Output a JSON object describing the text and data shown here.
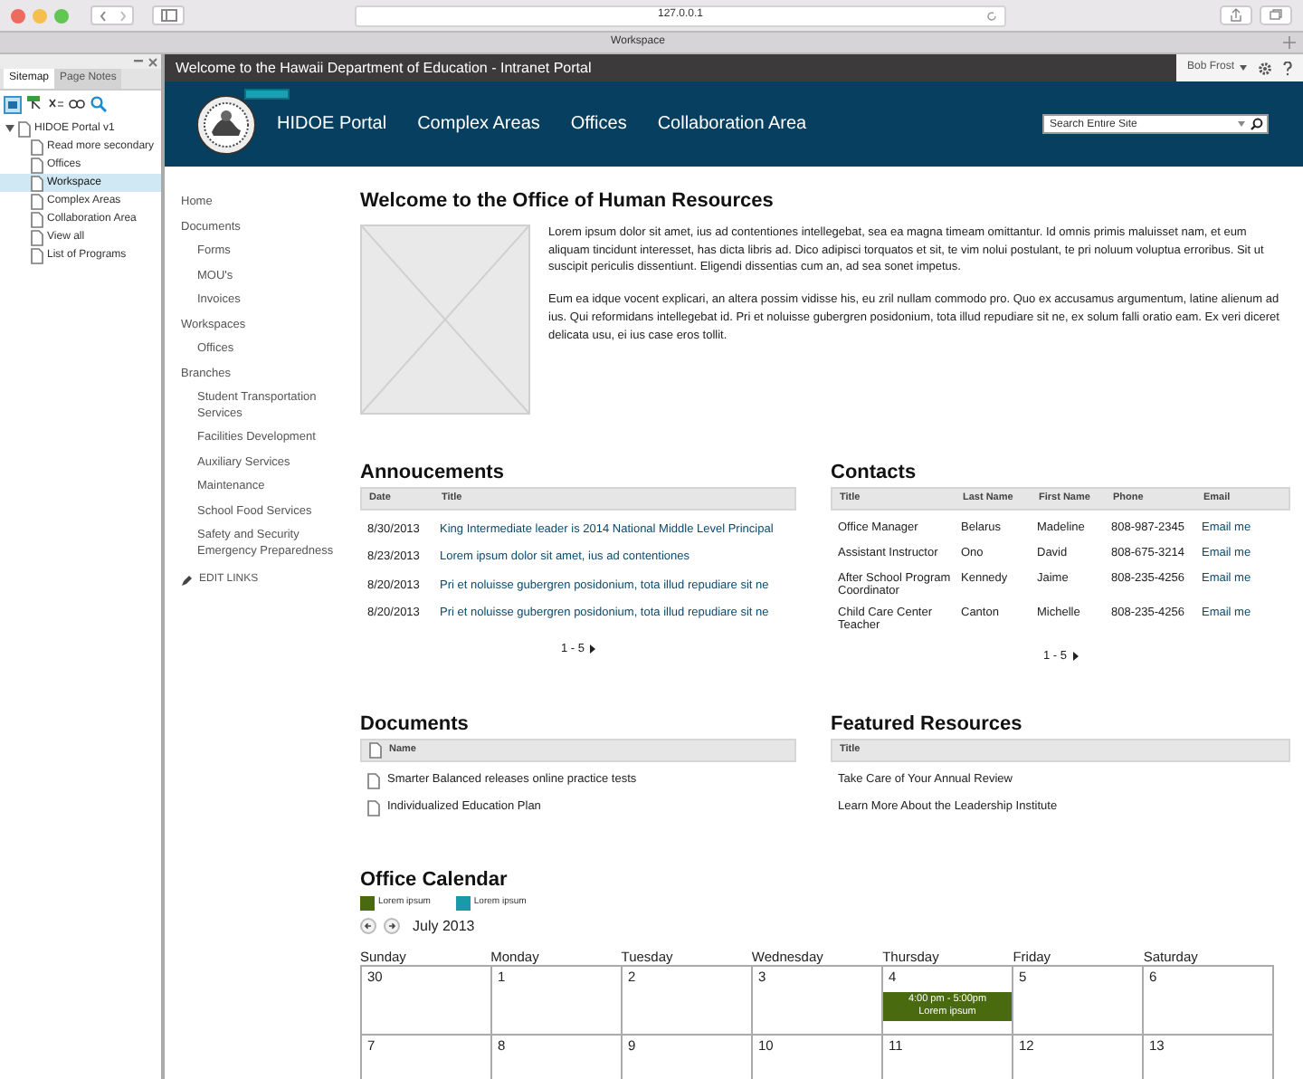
{
  "browser": {
    "url": "127.0.0.1",
    "tab_title": "Workspace"
  },
  "sitemap_panel": {
    "tabs": [
      {
        "label": "Sitemap",
        "selected": true
      },
      {
        "label": "Page Notes",
        "selected": false
      }
    ],
    "tree": [
      {
        "label": "HIDOE Portal v1",
        "expanded": true,
        "selected": false,
        "children": [
          {
            "label": "Read more secondary",
            "selected": false
          },
          {
            "label": "Offices",
            "selected": false
          },
          {
            "label": "Workspace",
            "selected": true
          },
          {
            "label": "Complex Areas",
            "selected": false
          },
          {
            "label": "Collaboration Area",
            "selected": false
          },
          {
            "label": "View all",
            "selected": false
          },
          {
            "label": "List of Programs",
            "selected": false
          }
        ]
      }
    ]
  },
  "top_bar": {
    "title": "Welcome to the Hawaii Department of Education - Intranet Portal",
    "user": "Bob Frost"
  },
  "header": {
    "nav": [
      "HIDOE Portal",
      "Complex Areas",
      "Offices",
      "Collaboration Area"
    ],
    "search": {
      "placeholder": "Search Entire Site"
    }
  },
  "left_nav": {
    "items": [
      {
        "label": "Home"
      },
      {
        "label": "Documents",
        "children": [
          {
            "label": "Forms"
          },
          {
            "label": "MOU's"
          },
          {
            "label": "Invoices"
          }
        ]
      },
      {
        "label": "Workspaces",
        "children": [
          {
            "label": "Offices"
          }
        ]
      },
      {
        "label": "Branches",
        "children": [
          {
            "label": "Student Transportation Services"
          },
          {
            "label": "Facilities Development"
          },
          {
            "label": "Auxiliary Services"
          },
          {
            "label": "Maintenance"
          },
          {
            "label": "School Food Services"
          },
          {
            "label": "Safety and Security Emergency Preparedness"
          }
        ]
      }
    ],
    "edit_links": "EDIT LINKS"
  },
  "intro": {
    "title": "Welcome to the Office of Human Resources",
    "paragraphs": [
      "Lorem ipsum dolor sit amet, ius ad contentiones intellegebat, sea ea magna timeam omittantur. Id omnis primis maluisset nam, et eum aliquam tincidunt interesset, has dicta libris ad. Dico adipisci torquatos et sit, te vim nolui postulant, te pri noluum voluptua erroribus. Sit ut suscipit periculis dissentiunt. Eligendi dissentias cum an, ad sea sonet impetus.",
      "Eum ea idque vocent explicari, an altera possim vidisse his, eu zril nullam commodo pro. Quo ex accusamus argumentum, latine alienum ad ius. Qui reformidans intellegebat id. Pri et noluisse gubergren posidonium, tota illud repudiare sit ne, ex solum falli oratio eam. Ex veri diceret delicata usu, ei ius case eros tollit."
    ]
  },
  "announcements": {
    "title": "Annoucements",
    "columns": [
      "Date",
      "Title"
    ],
    "rows": [
      [
        "8/30/2013",
        "King Intermediate leader is 2014 National Middle Level Principal"
      ],
      [
        "8/23/2013",
        "Lorem ipsum dolor sit amet, ius ad contentiones"
      ],
      [
        "8/20/2013",
        "Pri et noluisse gubergren posidonium, tota illud repudiare sit ne"
      ],
      [
        "8/20/2013",
        "Pri et noluisse gubergren posidonium, tota illud repudiare sit ne"
      ]
    ],
    "pager": "1 - 5"
  },
  "contacts": {
    "title": "Contacts",
    "columns": [
      "Title",
      "Last Name",
      "First Name",
      "Phone",
      "Email"
    ],
    "rows": [
      [
        "Office Manager",
        "Belarus",
        "Madeline",
        "808-987-2345",
        "Email me"
      ],
      [
        "Assistant Instructor",
        "Ono",
        "David",
        "808-675-3214",
        "Email me"
      ],
      [
        "After School Program Coordinator",
        "Kennedy",
        "Jaime",
        "808-235-4256",
        "Email me"
      ],
      [
        "Child Care Center Teacher",
        "Canton",
        "Michelle",
        "808-235-4256",
        "Email me"
      ]
    ],
    "pager": "1 - 5"
  },
  "documents": {
    "title": "Documents",
    "columns": [
      "Name"
    ],
    "rows": [
      "Smarter Balanced releases online practice tests",
      "Individualized Education Plan"
    ]
  },
  "featured_resources": {
    "title": "Featured Resources",
    "columns": [
      "Title"
    ],
    "rows": [
      "Take Care of Your Annual Review",
      "Learn More About the Leadership Institute"
    ]
  },
  "calendar": {
    "title": "Office Calendar",
    "legend": [
      {
        "label": "Lorem ipsum",
        "color": "#4a6a10"
      },
      {
        "label": "Lorem ipsum",
        "color": "#1a9aa8"
      }
    ],
    "month": "July 2013",
    "weekdays": [
      "Sunday",
      "Monday",
      "Tuesday",
      "Wednesday",
      "Thursday",
      "Friday",
      "Saturday"
    ],
    "weeks": [
      [
        {
          "day": "30"
        },
        {
          "day": "1"
        },
        {
          "day": "2"
        },
        {
          "day": "3"
        },
        {
          "day": "4",
          "events": [
            {
              "time": "4:00 pm - 5:00pm",
              "title": "Lorem ipsum",
              "color": "#4a6a10"
            }
          ]
        },
        {
          "day": "5"
        },
        {
          "day": "6"
        }
      ],
      [
        {
          "day": "7"
        },
        {
          "day": "8"
        },
        {
          "day": "9"
        },
        {
          "day": "10"
        },
        {
          "day": "11"
        },
        {
          "day": "12"
        },
        {
          "day": "13"
        }
      ]
    ]
  }
}
